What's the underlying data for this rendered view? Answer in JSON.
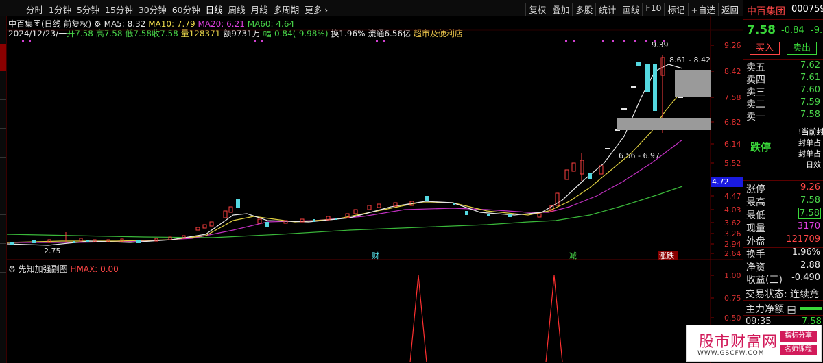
{
  "toolbar": {
    "periods": [
      "分时",
      "1分钟",
      "5分钟",
      "15分钟",
      "30分钟",
      "60分钟",
      "日线",
      "周线",
      "月线",
      "多周期",
      "更多"
    ],
    "active_period": "日线",
    "tools": [
      "复权",
      "叠加",
      "多股",
      "统计",
      "画线",
      "F10",
      "标记",
      "+自选",
      "返回"
    ]
  },
  "info": {
    "stock_title": "中百集团(日线 前复权)",
    "ma5": "MA5: 8.32",
    "ma10": "MA10: 7.79",
    "ma20": "MA20: 6.21",
    "ma60": "MA60: 4.64",
    "date": "2024/12/23/一",
    "open": "开7.58",
    "high": "高7.58",
    "low": "低7.58",
    "close": "收7.58",
    "volume": "量128371",
    "amount": "额9731万",
    "change": "幅-0.84(-9.98%)",
    "turnover": "换1.96%",
    "float_cap": "流通6.56亿",
    "sector": "超市及便利店"
  },
  "price_axis": [
    "9.26",
    "8.42",
    "7.58",
    "6.82",
    "6.14",
    "5.52",
    "4.47",
    "4.03",
    "3.62",
    "3.26",
    "2.94",
    "2.64"
  ],
  "current_price_tag": "4.72",
  "chart_labels": {
    "low_mark": "2.75",
    "high_mark": "9.39",
    "upper_range": "8.61 - 8.42",
    "lower_range": "6.56 - 6.97",
    "event_cai": "财",
    "event_jian": "减",
    "event_zhangdie": "涨跌"
  },
  "indicator": {
    "name": "先知加强副图",
    "hmax": "HMAX: 0.00",
    "axis": [
      "1.00",
      "0.75",
      "0.50"
    ]
  },
  "quote": {
    "name": "中百集团",
    "code": "000759",
    "price": "7.58",
    "change": "-0.84",
    "pct": "-9.98",
    "buy_label": "买入",
    "sell_label": "卖出",
    "asks": [
      {
        "label": "卖五",
        "price": "7.62"
      },
      {
        "label": "卖四",
        "price": "7.61"
      },
      {
        "label": "卖三",
        "price": "7.60"
      },
      {
        "label": "卖二",
        "price": "7.59"
      },
      {
        "label": "卖一",
        "price": "7.58"
      }
    ],
    "limit_down_label": "跌停",
    "limit_lines": [
      "!当前封",
      "封单占",
      "封单占",
      "十日效"
    ],
    "stats": [
      {
        "label": "涨停",
        "value": "9.26",
        "color": "#ff4646"
      },
      {
        "label": "最高",
        "value": "7.58",
        "color": "#3ad83a"
      },
      {
        "label": "最低",
        "value": "7.58",
        "color": "#3ad83a"
      },
      {
        "label": "现量",
        "value": "3170",
        "color": "#e040e0"
      },
      {
        "label": "外盘",
        "value": "121709",
        "color": "#ff4646"
      }
    ],
    "stats2": [
      {
        "label": "换手",
        "value": "1.96%",
        "color": "#ffffff"
      },
      {
        "label": "净资",
        "value": "2.88",
        "color": "#ffffff"
      },
      {
        "label": "收益(三)",
        "value": "-0.490",
        "color": "#ffffff"
      }
    ],
    "status": "交易状态: 连续竞",
    "netflow": "主力净额",
    "tick_time": "09:35",
    "tick_price": "7.58"
  },
  "watermark": {
    "title": "股市财富网",
    "url": "WWW.GSCFW.COM",
    "tag1": "指标分享",
    "tag2": "名师课程"
  },
  "colors": {
    "rise": "#ff4646",
    "fall": "#54d8e0",
    "ma5": "#e6e6e6",
    "ma10": "#e8d64a",
    "ma20": "#e040e0",
    "ma60": "#49d449"
  }
}
